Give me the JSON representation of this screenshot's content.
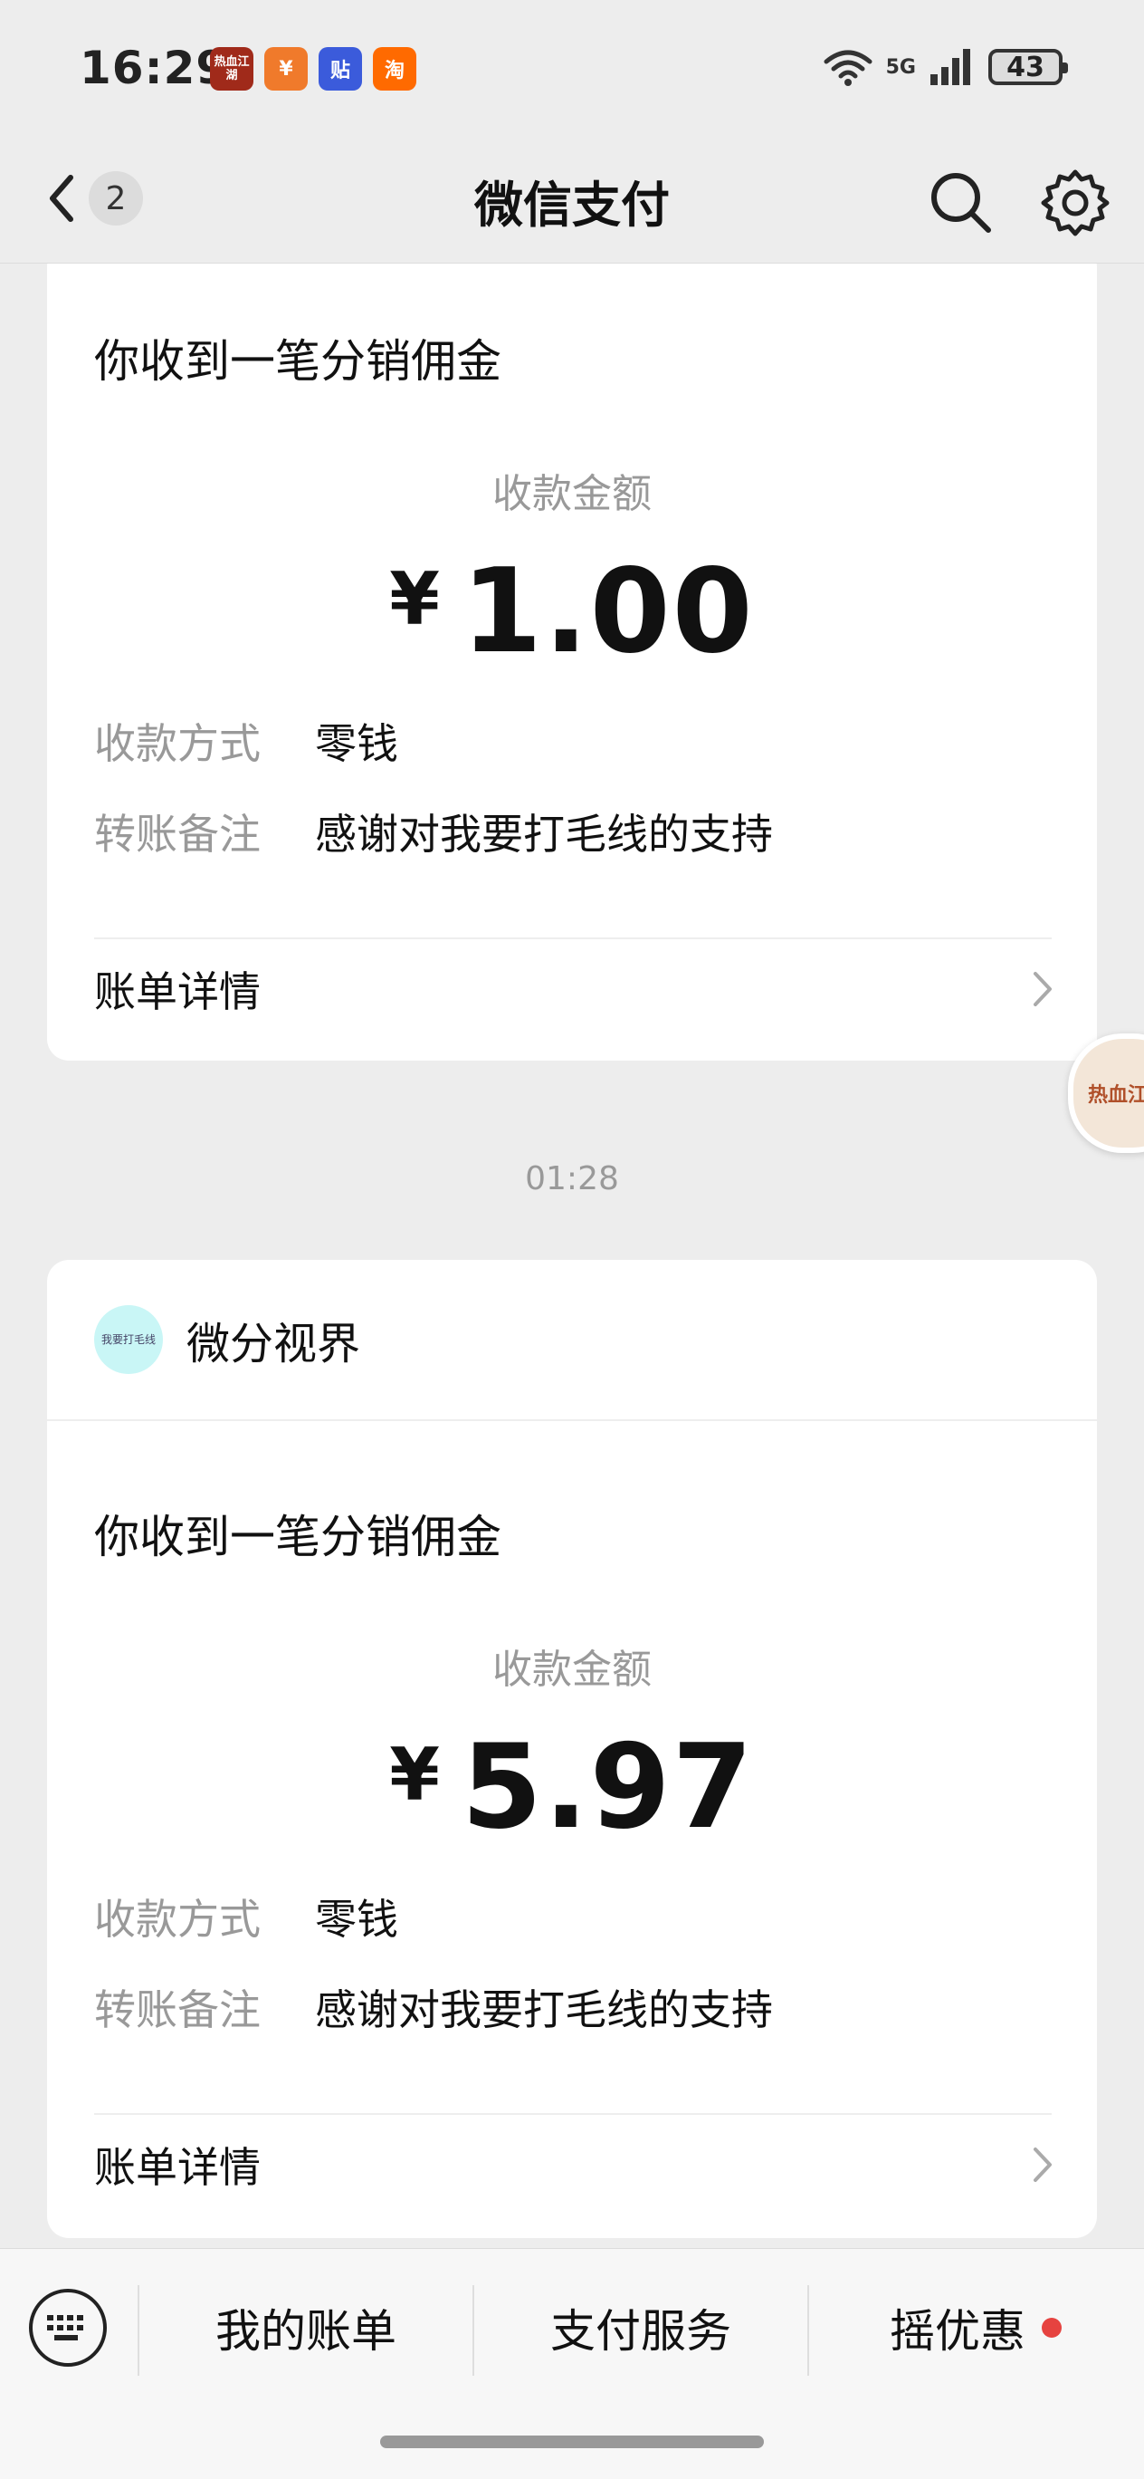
{
  "status_bar": {
    "time": "16:29",
    "app_icons": [
      {
        "name": "game-app-icon",
        "label": "热血江湖",
        "color": "#a02a1a"
      },
      {
        "name": "orange-app-icon",
        "label": "¥",
        "color": "#f07a2b"
      },
      {
        "name": "tieba-app-icon",
        "label": "贴",
        "color": "#3b5bdb"
      },
      {
        "name": "taobao-app-icon",
        "label": "淘",
        "color": "#ff6a00"
      }
    ],
    "network": "5G",
    "battery": "43"
  },
  "nav": {
    "back_badge": "2",
    "title": "微信支付"
  },
  "messages": [
    {
      "title": "你收到一笔分销佣金",
      "amount_label": "收款金额",
      "currency": "¥",
      "amount": "1.00",
      "method_label": "收款方式",
      "method_value": "零钱",
      "note_label": "转账备注",
      "note_value": "感谢对我要打毛线的支持",
      "detail_label": "账单详情"
    },
    {
      "timestamp": "01:28",
      "brand_name": "微分视界",
      "brand_avatar_text": "我要打毛线",
      "title": "你收到一笔分销佣金",
      "amount_label": "收款金额",
      "currency": "¥",
      "amount": "5.97",
      "method_label": "收款方式",
      "method_value": "零钱",
      "note_label": "转账备注",
      "note_value": "感谢对我要打毛线的支持",
      "detail_label": "账单详情"
    }
  ],
  "floating_bubble_text": "热血江湖",
  "bottom_bar": {
    "tabs": [
      "我的账单",
      "支付服务",
      "摇优惠"
    ]
  },
  "colors": {
    "background": "#ededed",
    "card": "#ffffff",
    "muted_text": "#999999",
    "red_dot": "#e64340"
  }
}
